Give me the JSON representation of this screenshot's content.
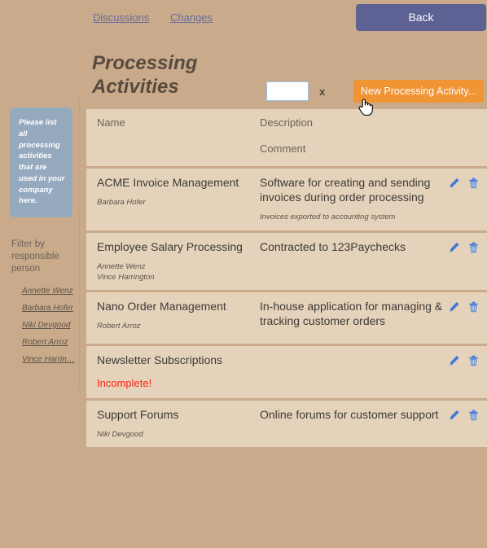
{
  "topbar": {
    "links": [
      {
        "label": "Discussions",
        "name": "discussions"
      },
      {
        "label": "Changes",
        "name": "changes"
      }
    ],
    "back_label": "Back"
  },
  "sidebar": {
    "hint": "Please list all processing activities that are used in your company here.",
    "filter_title": "Filter by responsible person",
    "filter_people": [
      "Annette Wenz",
      "Barbara Hofer",
      "Niki Devgood",
      "Robert Arroz",
      "Vince Harrin…"
    ]
  },
  "main": {
    "title": "Processing Activities",
    "search_value": "",
    "search_placeholder": "",
    "search_clear_label": "x",
    "new_button_label": "New Processing Activity..."
  },
  "table": {
    "headers": {
      "name": "Name",
      "description": "Description",
      "comment": "Comment"
    },
    "row_actions": {
      "edit_label": "edit-pencil-icon",
      "delete_label": "delete-trash-icon"
    },
    "rows": [
      {
        "name": "ACME Invoice Management",
        "responsible": "Barbara Hofer",
        "description": "Software for creating and sending invoices during order processing",
        "comment": "Invoices exported to accounting system",
        "status": ""
      },
      {
        "name": "Employee Salary Processing",
        "responsible": "Annette Wenz\nVince Harrington",
        "description": "Contracted to 123Paychecks",
        "comment": "",
        "status": ""
      },
      {
        "name": "Nano Order Management",
        "responsible": "Robert Arroz",
        "description": "In-house application for managing & tracking customer orders",
        "comment": "",
        "status": ""
      },
      {
        "name": "Newsletter Subscriptions",
        "responsible": "",
        "description": "",
        "comment": "",
        "status": "Incomplete!"
      },
      {
        "name": "Support Forums",
        "responsible": "Niki Devgood",
        "description": "Online forums for customer support",
        "comment": "",
        "status": ""
      }
    ]
  },
  "colors": {
    "page_background": "#c9ab8c",
    "row_background": "#e5d2ba",
    "accent_orange": "#f09434",
    "back_purple": "#5d6193",
    "hint_blue": "#95aabe",
    "icon_blue": "#3f79d4",
    "error_red": "#ff2418"
  }
}
